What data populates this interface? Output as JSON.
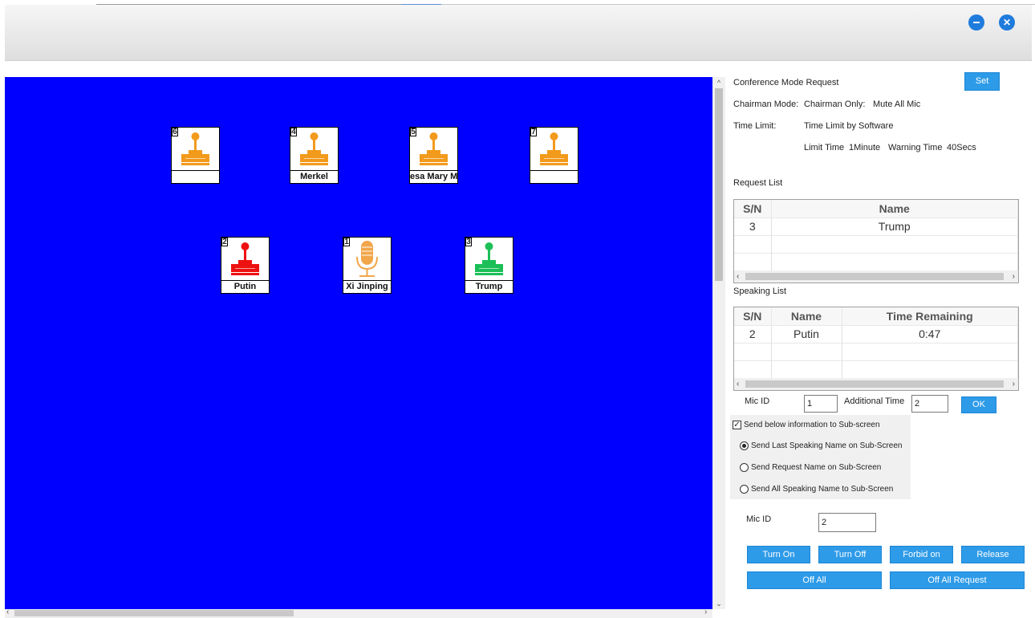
{
  "window": {
    "minimize_label": "–",
    "close_label": "✕"
  },
  "seats": [
    {
      "id": "6",
      "name": "",
      "type": "chair",
      "color": "#f29a1c"
    },
    {
      "id": "4",
      "name": "Merkel",
      "type": "chair",
      "color": "#f29a1c"
    },
    {
      "id": "5",
      "name": "esa Mary M",
      "type": "chair",
      "color": "#f29a1c"
    },
    {
      "id": "7",
      "name": "",
      "type": "chair",
      "color": "#f29a1c"
    },
    {
      "id": "2",
      "name": "Putin",
      "type": "chair",
      "color": "#ee1111"
    },
    {
      "id": "1",
      "name": "Xi Jinping",
      "type": "mic",
      "color": "#f2a64a"
    },
    {
      "id": "3",
      "name": "Trump",
      "type": "chair",
      "color": "#1cbf57"
    }
  ],
  "panel": {
    "mode_request_label": "Conference Mode Request",
    "set_button": "Set",
    "chairman_mode_label": "Chairman Mode:",
    "chairman_mode_value": "Chairman Only:",
    "mute_label": "Mute All Mic",
    "time_limit_label": "Time Limit:",
    "time_limit_value": "Time Limit by Software",
    "limit_time_label": "Limit Time",
    "limit_time_value": "1Minute",
    "warning_time_label": "Warning Time",
    "warning_time_value": "40Secs",
    "request_list_title": "Request List",
    "request_list": {
      "columns": [
        "S/N",
        "Name"
      ],
      "rows": [
        [
          "3",
          "Trump"
        ]
      ]
    },
    "speaking_list_title": "Speaking List",
    "speaking_list": {
      "columns": [
        "S/N",
        "Name",
        "Time Remaining"
      ],
      "rows": [
        [
          "2",
          "Putin",
          "0:47"
        ]
      ]
    },
    "mic_id_label": "Mic ID",
    "mic_id_value": "1",
    "additional_time_label": "Additional Time",
    "additional_time_value": "2",
    "ok_button": "OK",
    "subscreen_checkbox_label": "Send below information to Sub-screen",
    "subscreen_checked": true,
    "options": [
      {
        "label": "Send Last Speaking Name on Sub-Screen",
        "selected": true
      },
      {
        "label": "Send Request Name on Sub-Screen",
        "selected": false
      },
      {
        "label": "Send All Speaking Name to Sub-Screen",
        "selected": false
      }
    ],
    "mic_id2_label": "Mic ID",
    "mic_id2_value": "2",
    "buttons": {
      "turn_on": "Turn On",
      "turn_off": "Turn Off",
      "forbid_on": "Forbid on",
      "release": "Release",
      "off_all": "Off All",
      "off_all_request": "Off All Request"
    }
  },
  "colors": {
    "canvas_bg": "#0000ff",
    "accent": "#2e9be8"
  }
}
